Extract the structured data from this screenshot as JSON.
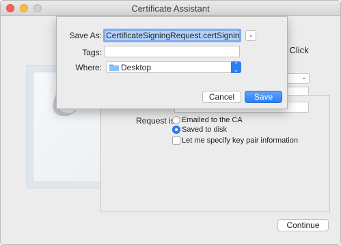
{
  "window": {
    "title": "Certificate Assistant"
  },
  "background": {
    "partial_text": "g. Click",
    "request_label": "Request is:",
    "options": [
      {
        "label": "Emailed to the CA",
        "selected": false
      },
      {
        "label": "Saved to disk",
        "selected": true
      }
    ],
    "checkbox_label": "Let me specify key pair information",
    "continue_label": "Continue"
  },
  "sheet": {
    "save_as_label": "Save As:",
    "save_as_value": "CertificateSigningRequest.certSigningRe",
    "tags_label": "Tags:",
    "where_label": "Where:",
    "where_value": "Desktop",
    "cancel_label": "Cancel",
    "save_label": "Save"
  },
  "icons": {
    "expand": "chevron-down-icon",
    "folder": "folder-icon",
    "stepper": "up-down-chevron-icon"
  },
  "colors": {
    "accent": "#2b7ff4",
    "close": "#fc605c",
    "minimize": "#fdbc40"
  }
}
